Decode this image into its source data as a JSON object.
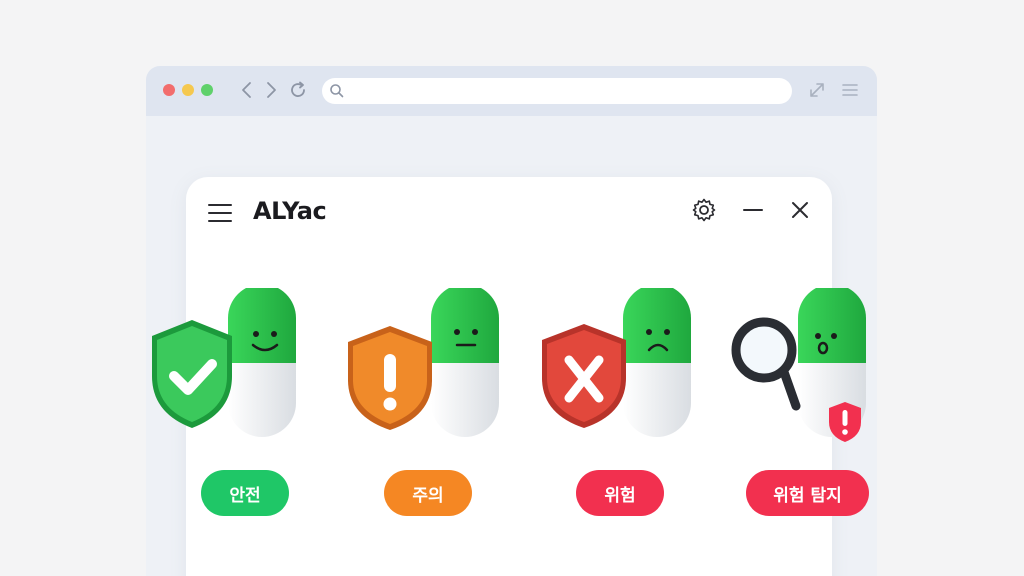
{
  "browser": {
    "icons": [
      "back-icon",
      "forward-icon",
      "reload-icon",
      "search-icon",
      "expand-icon",
      "menu-icon"
    ],
    "address_value": ""
  },
  "app": {
    "title": "ALYac",
    "header_icons": [
      "menu-icon",
      "gear-icon",
      "minimize-icon",
      "close-icon"
    ]
  },
  "statuses": [
    {
      "label": "안전",
      "color": "#1fc767",
      "icon": "check-shield-icon"
    },
    {
      "label": "주의",
      "color": "#f58723",
      "icon": "exclamation-shield-icon"
    },
    {
      "label": "위험",
      "color": "#f2304f",
      "icon": "x-shield-icon"
    },
    {
      "label": "위험 탐지",
      "color": "#f2304f",
      "icon": "magnifier-icon"
    }
  ]
}
